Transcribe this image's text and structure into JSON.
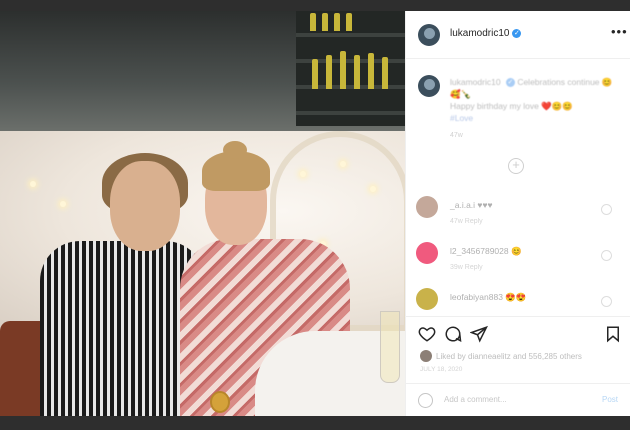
{
  "post": {
    "username": "lukamodric10",
    "more_icon": "more-options-icon"
  },
  "caption": {
    "username": "lukamodric10",
    "text_line1": "Celebrations continue",
    "text_line2": "Happy birthday my love",
    "hashtag": "#Love",
    "time": "47w"
  },
  "comments": [
    {
      "user": "_a.i.a.i",
      "text": "♥♥♥",
      "meta": "47w  Reply",
      "avatar_color": "#c4a89a"
    },
    {
      "user": "l2_3456789028",
      "text": "😊",
      "meta": "39w  Reply",
      "avatar_color": "#f05a7e"
    },
    {
      "user": "leofabiyan883",
      "text": "😍😍",
      "meta": "",
      "avatar_color": "#c9b24a"
    }
  ],
  "likes": {
    "text": "Liked by dianneaelitz and 556,285 others"
  },
  "date": "JULY 18, 2020",
  "add_comment": {
    "placeholder": "Add a comment...",
    "post_label": "Post"
  },
  "colors": {
    "link_blue": "#3897f0",
    "text_dark": "#262626"
  }
}
